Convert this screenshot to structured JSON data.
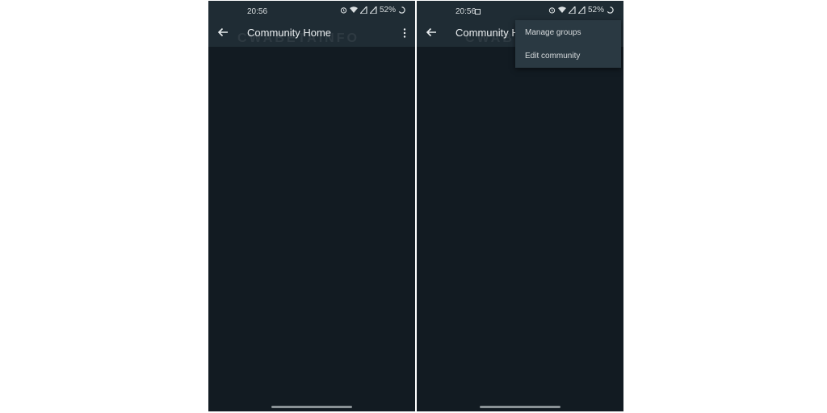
{
  "screens": [
    {
      "status": {
        "time": "20:56",
        "battery": "52%"
      },
      "header": {
        "title": "Community Home"
      },
      "watermark": "CWABETAINFO"
    },
    {
      "status": {
        "time": "20:56",
        "battery": "52%"
      },
      "header": {
        "title": "Community H"
      },
      "watermark": "CWABETAINFO",
      "menu": {
        "items": [
          "Manage groups",
          "Edit community"
        ]
      }
    }
  ],
  "icons": [
    "back-arrow-icon",
    "more-vert-icon",
    "alarm-icon",
    "wifi-icon",
    "signal-icon",
    "battery-circle-icon",
    "image-icon"
  ],
  "colors": {
    "background": "#121b22",
    "toolbar": "#1f2c34",
    "menu": "#2a3942",
    "text": "#e9edef"
  }
}
